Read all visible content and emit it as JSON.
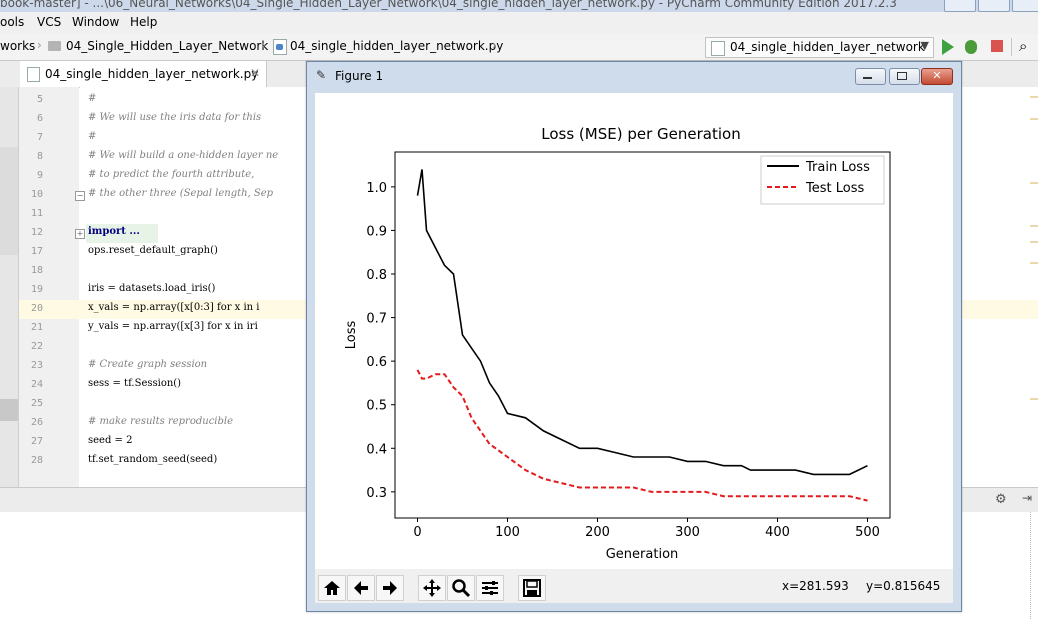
{
  "titlebar": {
    "text": "book-master] - ...\\06_Neural_Networks\\04_Single_Hidden_Layer_Network\\04_single_hidden_layer_network.py - PyCharm Community Edition 2017.2.3"
  },
  "menu": [
    "ools",
    "VCS",
    "Window",
    "Help"
  ],
  "breadcrumbs": [
    "works",
    "04_Single_Hidden_Layer_Network",
    "04_single_hidden_layer_network.py"
  ],
  "run_config": "04_single_hidden_layer_network",
  "editor_tab": "04_single_hidden_layer_network.py",
  "code": [
    {
      "n": "5",
      "text": "#",
      "kind": "comment"
    },
    {
      "n": "6",
      "text": "# We will use the iris data for this",
      "kind": "comment"
    },
    {
      "n": "7",
      "text": "#",
      "kind": "comment"
    },
    {
      "n": "8",
      "text": "# We will build a one-hidden layer ne",
      "kind": "comment"
    },
    {
      "n": "9",
      "text": "#  to predict the fourth attribute, ",
      "kind": "comment"
    },
    {
      "n": "10",
      "text": "#  the other three (Sepal length, Sep",
      "kind": "comment"
    },
    {
      "n": "11",
      "text": "",
      "kind": "plain"
    },
    {
      "n": "12",
      "text": "import ...",
      "kind": "kw"
    },
    {
      "n": "17",
      "text": "ops.reset_default_graph()",
      "kind": "plain"
    },
    {
      "n": "18",
      "text": "",
      "kind": "plain"
    },
    {
      "n": "19",
      "text": "iris = datasets.load_iris()",
      "kind": "plain"
    },
    {
      "n": "20",
      "text": "x_vals = np.array([x[0:3] for x in i",
      "kind": "plain"
    },
    {
      "n": "21",
      "text": "y_vals = np.array([x[3] for x in iri",
      "kind": "plain"
    },
    {
      "n": "22",
      "text": "",
      "kind": "plain"
    },
    {
      "n": "23",
      "text": "# Create graph session",
      "kind": "comment"
    },
    {
      "n": "24",
      "text": "sess = tf.Session()",
      "kind": "plain"
    },
    {
      "n": "25",
      "text": "",
      "kind": "plain"
    },
    {
      "n": "26",
      "text": "# make results reproducible",
      "kind": "comment"
    },
    {
      "n": "27",
      "text": "seed = 2",
      "kind": "plain"
    },
    {
      "n": "28",
      "text": "tf.set_random_seed(seed)",
      "kind": "plain"
    }
  ],
  "figure": {
    "window_title": "Figure 1",
    "coord_x": "x=281.593",
    "coord_y": "y=0.815645",
    "toolbar": [
      "home-icon",
      "back-arrow-icon",
      "forward-arrow-icon",
      "pan-icon",
      "zoom-icon",
      "subplots-icon",
      "save-icon"
    ]
  },
  "colors": {
    "train": "#000000",
    "test": "#e41a1c",
    "figure_frame": "#cfdcec"
  },
  "chart_data": {
    "type": "line",
    "title": "Loss (MSE) per Generation",
    "xlabel": "Generation",
    "ylabel": "Loss",
    "xlim": [
      -25,
      525
    ],
    "ylim": [
      0.24,
      1.08
    ],
    "xticks": [
      0,
      100,
      200,
      300,
      400,
      500
    ],
    "yticks": [
      0.3,
      0.4,
      0.5,
      0.6,
      0.7,
      0.8,
      0.9,
      1.0
    ],
    "legend_position": "top-right",
    "series": [
      {
        "name": "Train Loss",
        "style": "solid",
        "x": [
          0,
          5,
          10,
          20,
          30,
          40,
          50,
          60,
          70,
          80,
          90,
          100,
          120,
          140,
          160,
          180,
          200,
          220,
          240,
          260,
          280,
          300,
          320,
          340,
          360,
          370,
          380,
          400,
          420,
          440,
          460,
          480,
          500
        ],
        "y": [
          0.98,
          1.04,
          0.9,
          0.86,
          0.82,
          0.8,
          0.66,
          0.63,
          0.6,
          0.55,
          0.52,
          0.48,
          0.47,
          0.44,
          0.42,
          0.4,
          0.4,
          0.39,
          0.38,
          0.38,
          0.38,
          0.37,
          0.37,
          0.36,
          0.36,
          0.35,
          0.35,
          0.35,
          0.35,
          0.34,
          0.34,
          0.34,
          0.36
        ]
      },
      {
        "name": "Test Loss",
        "style": "dashed",
        "x": [
          0,
          5,
          10,
          20,
          30,
          40,
          50,
          60,
          70,
          80,
          100,
          120,
          140,
          160,
          180,
          200,
          220,
          240,
          260,
          280,
          300,
          320,
          340,
          360,
          380,
          400,
          420,
          440,
          460,
          480,
          500
        ],
        "y": [
          0.58,
          0.56,
          0.56,
          0.57,
          0.57,
          0.54,
          0.52,
          0.47,
          0.44,
          0.41,
          0.38,
          0.35,
          0.33,
          0.32,
          0.31,
          0.31,
          0.31,
          0.31,
          0.3,
          0.3,
          0.3,
          0.3,
          0.29,
          0.29,
          0.29,
          0.29,
          0.29,
          0.29,
          0.29,
          0.29,
          0.28
        ]
      }
    ]
  }
}
